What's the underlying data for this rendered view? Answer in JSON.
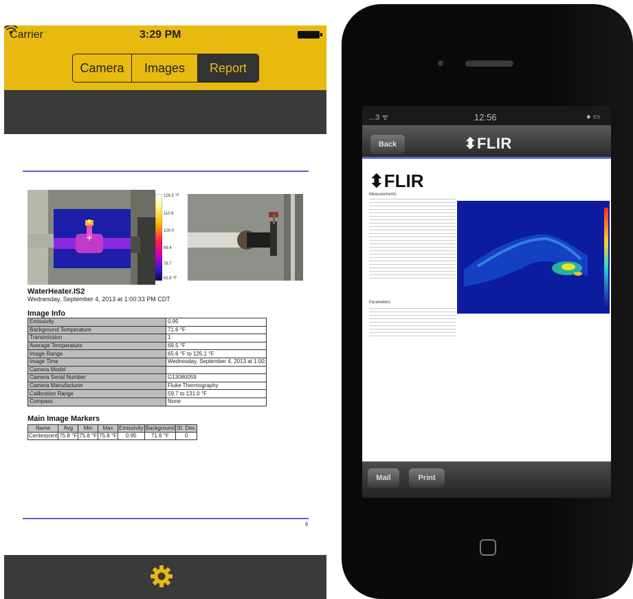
{
  "app": {
    "status_bar": {
      "carrier": "Carrier",
      "time": "3:29 PM"
    },
    "segments": {
      "camera": "Camera",
      "images": "Images",
      "report": "Report",
      "selected": "Report"
    },
    "colors": {
      "header_yellow": "#e8ba10",
      "bar_dark": "#3a3a3a",
      "accent_rule": "#5a5ccd"
    },
    "icons": {
      "wifi": "wifi-icon",
      "battery": "battery-icon",
      "settings": "gear-icon"
    }
  },
  "report": {
    "scale_labels": [
      "126.5 °F",
      "110.6",
      "100.0",
      "89.4",
      "78.7",
      "62.8 °F"
    ],
    "file_name": "WaterHeater.IS2",
    "file_date": "Wednesday, September 4, 2013 at 1:00:33 PM CDT",
    "image_info_title": "Image Info",
    "image_info": [
      {
        "k": "Emissivity",
        "v": "0.95"
      },
      {
        "k": "Background Temperature",
        "v": "71.6 °F"
      },
      {
        "k": "Transmission",
        "v": "1"
      },
      {
        "k": "Average Temperature",
        "v": "69.5 °F"
      },
      {
        "k": "Image Range",
        "v": "65.6 °F to 125.1 °F"
      },
      {
        "k": "Image Time",
        "v": "Wednesday, September 4, 2013 at 1:00:33..."
      },
      {
        "k": "Camera Model",
        "v": ""
      },
      {
        "k": "Camera Serial Number",
        "v": "G13080059"
      },
      {
        "k": "Camera Manufacturer",
        "v": "Fluke Thermography"
      },
      {
        "k": "Calibration Range",
        "v": "59.7 to 131.0 °F"
      },
      {
        "k": "Compass",
        "v": "None"
      }
    ],
    "markers_title": "Main Image Markers",
    "markers_header": [
      "Name",
      "Avg",
      "Min",
      "Max",
      "Emissivity",
      "Background",
      "St. Dev."
    ],
    "markers_rows": [
      [
        "Centerpoint",
        "75.8 °F",
        "75.8 °F",
        "75.8 °F",
        "0.95",
        "71.6 °F",
        "0"
      ]
    ],
    "page_number": "6"
  },
  "phone": {
    "status": {
      "carrier": "...3 ᯤ",
      "time": "12:56"
    },
    "back_label": "Back",
    "logo": "FLIR",
    "page_logo": "FLIR",
    "measurements_title": "Measurements",
    "parameters_title": "Parameters",
    "mail_label": "Mail",
    "print_label": "Print"
  }
}
